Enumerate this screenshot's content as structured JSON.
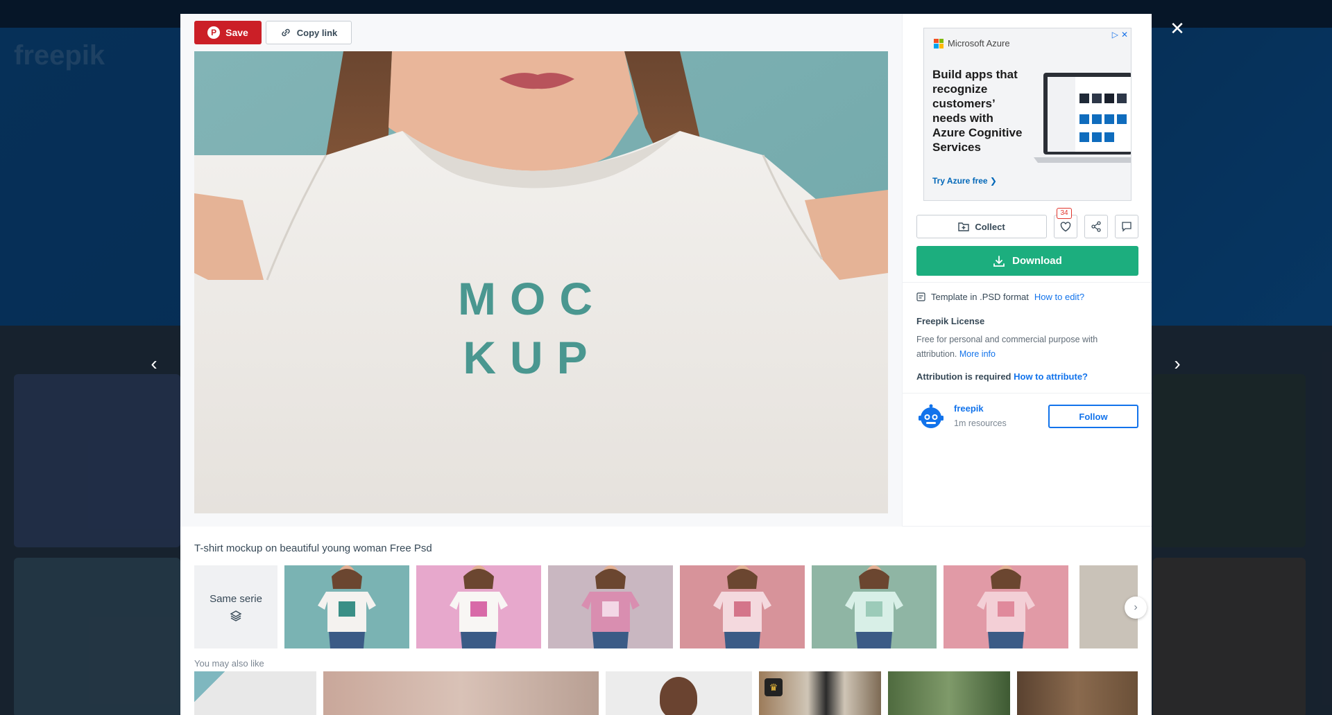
{
  "page_title": "T-shirt mockup on beautiful young woman Free Psd",
  "background": {
    "logo": "freepik"
  },
  "toolbar": {
    "save_label": "Save",
    "copy_link_label": "Copy link"
  },
  "main_image": {
    "mockup_line1": "MOC",
    "mockup_line2": "KUP"
  },
  "ad": {
    "brand": "Microsoft Azure",
    "headline": "Build apps that recognize customers’ needs with Azure Cognitive Services",
    "cta": "Try Azure free ❯"
  },
  "actions": {
    "collect_label": "Collect",
    "like_count": "34",
    "download_label": "Download"
  },
  "details": {
    "format_text": "Template in .PSD format",
    "how_to_edit": "How to edit?",
    "license_title": "Freepik License",
    "license_desc": "Free for personal and commercial purpose with attribution.",
    "more_info": "More info",
    "attribution_text": "Attribution is required",
    "how_to_attribute": "How to attribute?"
  },
  "author": {
    "name": "freepik",
    "resources": "1m resources",
    "follow_label": "Follow"
  },
  "series": {
    "same_serie_label": "Same serie",
    "thumbs": [
      {
        "bg": "#7ab3b3",
        "shirt": "#f4f2ef",
        "print": "#3a8f86"
      },
      {
        "bg": "#e7a8cc",
        "shirt": "#f8f6f4",
        "print": "#d86aa8"
      },
      {
        "bg": "#c9b7c1",
        "shirt": "#d98eb0",
        "print": "#f3d7e6"
      },
      {
        "bg": "#d7939a",
        "shirt": "#f4d9de",
        "print": "#d4758a"
      },
      {
        "bg": "#8fb5a4",
        "shirt": "#d8efe7",
        "print": "#9ccbb9"
      },
      {
        "bg": "#e19aa6",
        "shirt": "#f3cfd6",
        "print": "#e08a9c"
      }
    ]
  },
  "also_like_label": "You may also like",
  "colors": {
    "save_red": "#cb1f27",
    "download_green": "#1cae7e",
    "link_blue": "#1273eb"
  }
}
